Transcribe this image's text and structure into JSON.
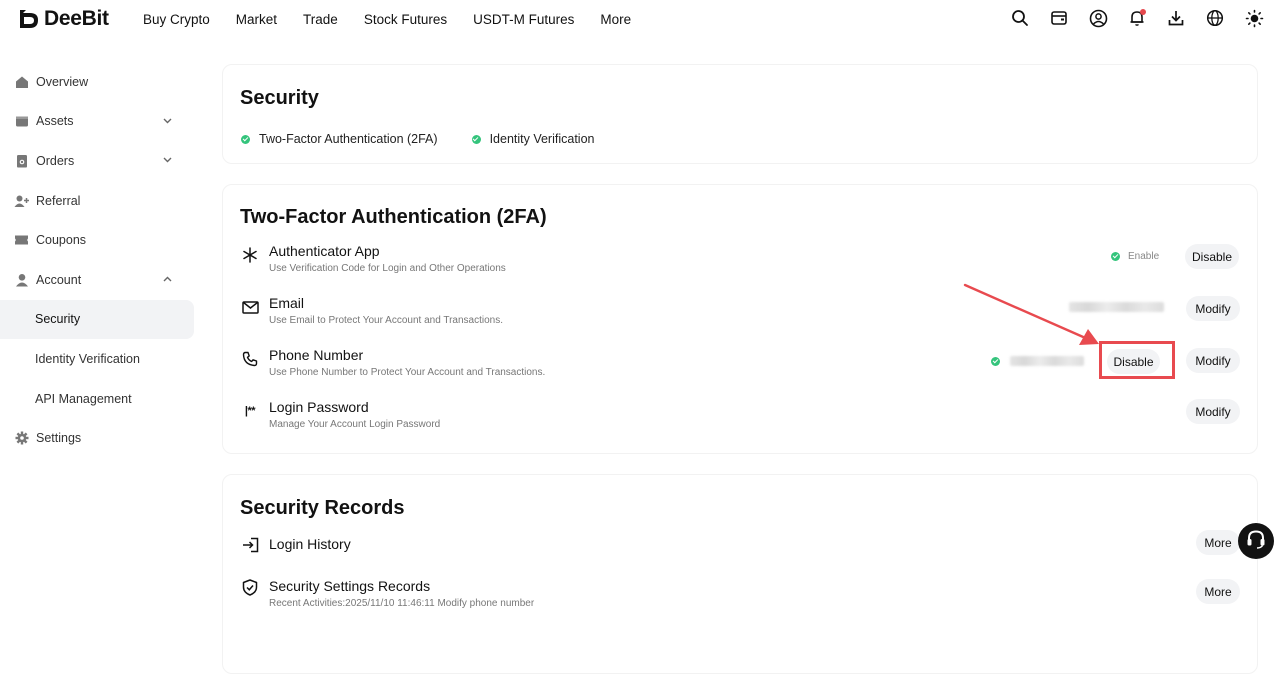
{
  "brand": {
    "name": "DeeBit"
  },
  "nav": {
    "items": [
      "Buy Crypto",
      "Market",
      "Trade",
      "Stock Futures",
      "USDT-M Futures",
      "More"
    ]
  },
  "top_icons": [
    "search-icon",
    "wallet-icon",
    "profile-icon",
    "bell-icon",
    "download-icon",
    "globe-icon",
    "theme-sun-icon"
  ],
  "sidebar": {
    "items": [
      {
        "label": "Overview",
        "icon": "home-icon"
      },
      {
        "label": "Assets",
        "icon": "wallet-icon",
        "chevron": "down"
      },
      {
        "label": "Orders",
        "icon": "orders-icon",
        "chevron": "down"
      },
      {
        "label": "Referral",
        "icon": "user-plus-icon"
      },
      {
        "label": "Coupons",
        "icon": "ticket-icon"
      },
      {
        "label": "Account",
        "icon": "person-icon",
        "chevron": "up"
      },
      {
        "label": "Security",
        "sub": true,
        "active": true
      },
      {
        "label": "Identity Verification",
        "sub": true
      },
      {
        "label": "API Management",
        "sub": true
      },
      {
        "label": "Settings",
        "icon": "gear-icon"
      }
    ]
  },
  "security_card": {
    "title": "Security",
    "checks": [
      "Two-Factor Authentication (2FA)",
      "Identity Verification"
    ]
  },
  "tfa_card": {
    "title": "Two-Factor Authentication (2FA)",
    "rows": [
      {
        "icon": "asterisk-icon",
        "title": "Authenticator App",
        "desc": "Use Verification Code for Login and Other Operations",
        "status": "Enable",
        "button": "Disable"
      },
      {
        "icon": "mail-icon",
        "title": "Email",
        "desc": "Use Email to Protect Your Account and Transactions.",
        "button": "Modify"
      },
      {
        "icon": "phone-icon",
        "title": "Phone Number",
        "desc": "Use Phone Number to Protect Your Account and Transactions.",
        "button2": "Disable",
        "button": "Modify"
      },
      {
        "icon": "password-icon",
        "title": "Login Password",
        "desc": "Manage Your Account Login Password",
        "button": "Modify"
      }
    ]
  },
  "records_card": {
    "title": "Security Records",
    "rows": [
      {
        "icon": "login-icon",
        "title": "Login History",
        "button": "More"
      },
      {
        "icon": "shield-check-icon",
        "title": "Security Settings Records",
        "desc": "Recent Activities:2025/11/10 11:46:11 Modify phone number",
        "button": "More"
      }
    ]
  },
  "colors": {
    "accent_green": "#34c47c",
    "annotation_red": "#e84a4f",
    "notification_red": "#e5484d"
  }
}
